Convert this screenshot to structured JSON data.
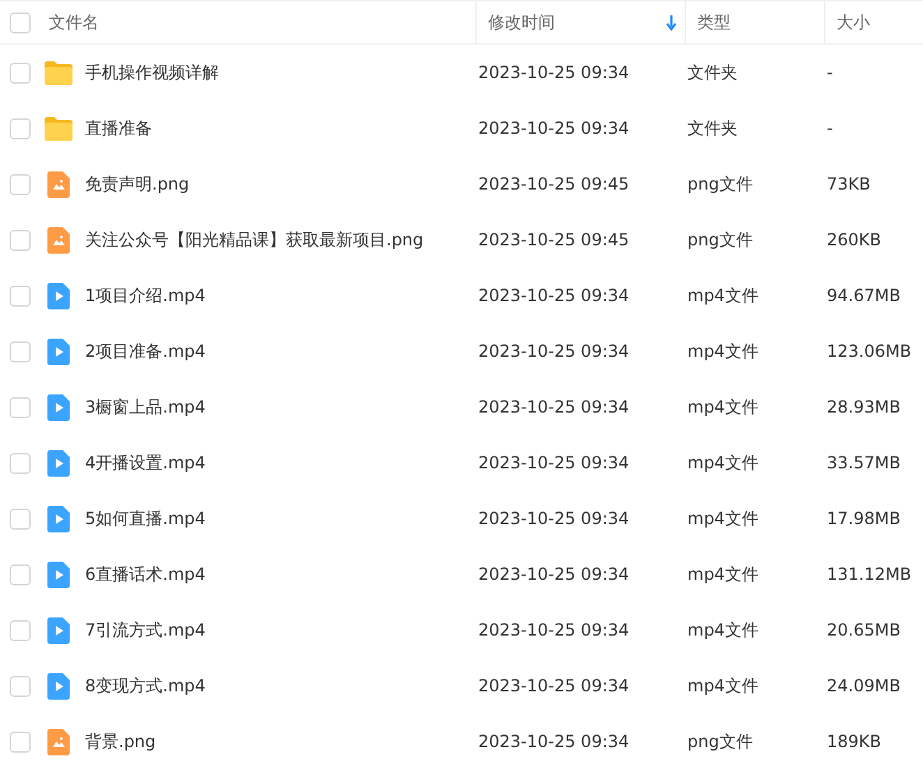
{
  "table": {
    "select_all": {
      "checked": false
    },
    "columns": [
      {
        "label": "文件名",
        "sorted": false
      },
      {
        "label": "修改时间",
        "sorted": true
      },
      {
        "label": "类型",
        "sorted": false
      },
      {
        "label": "大小",
        "sorted": false
      }
    ],
    "rows": [
      {
        "kind": "folder",
        "checked": false,
        "name": "手机操作视频详解",
        "modified": "2023-10-25 09:34",
        "type": "文件夹",
        "size": "-"
      },
      {
        "kind": "folder",
        "checked": false,
        "name": "直播准备",
        "modified": "2023-10-25 09:34",
        "type": "文件夹",
        "size": "-"
      },
      {
        "kind": "image",
        "checked": false,
        "name": "免责声明.png",
        "modified": "2023-10-25 09:45",
        "type": "png文件",
        "size": "73KB"
      },
      {
        "kind": "image",
        "checked": false,
        "name": "关注公众号【阳光精品课】获取最新项目.png",
        "modified": "2023-10-25 09:45",
        "type": "png文件",
        "size": "260KB"
      },
      {
        "kind": "video",
        "checked": false,
        "name": "1项目介绍.mp4",
        "modified": "2023-10-25 09:34",
        "type": "mp4文件",
        "size": "94.67MB"
      },
      {
        "kind": "video",
        "checked": false,
        "name": "2项目准备.mp4",
        "modified": "2023-10-25 09:34",
        "type": "mp4文件",
        "size": "123.06MB"
      },
      {
        "kind": "video",
        "checked": false,
        "name": "3橱窗上品.mp4",
        "modified": "2023-10-25 09:34",
        "type": "mp4文件",
        "size": "28.93MB"
      },
      {
        "kind": "video",
        "checked": false,
        "name": "4开播设置.mp4",
        "modified": "2023-10-25 09:34",
        "type": "mp4文件",
        "size": "33.57MB"
      },
      {
        "kind": "video",
        "checked": false,
        "name": "5如何直播.mp4",
        "modified": "2023-10-25 09:34",
        "type": "mp4文件",
        "size": "17.98MB"
      },
      {
        "kind": "video",
        "checked": false,
        "name": "6直播话术.mp4",
        "modified": "2023-10-25 09:34",
        "type": "mp4文件",
        "size": "131.12MB"
      },
      {
        "kind": "video",
        "checked": false,
        "name": "7引流方式.mp4",
        "modified": "2023-10-25 09:34",
        "type": "mp4文件",
        "size": "20.65MB"
      },
      {
        "kind": "video",
        "checked": false,
        "name": "8变现方式.mp4",
        "modified": "2023-10-25 09:34",
        "type": "mp4文件",
        "size": "24.09MB"
      },
      {
        "kind": "image",
        "checked": false,
        "name": "背景.png",
        "modified": "2023-10-25 09:34",
        "type": "png文件",
        "size": "189KB"
      }
    ]
  }
}
